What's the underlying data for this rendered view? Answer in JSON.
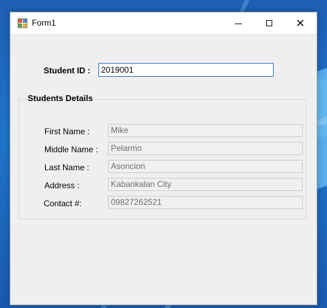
{
  "window": {
    "title": "Form1"
  },
  "student_id": {
    "label": "Student ID :",
    "value": "2019001"
  },
  "student_details": {
    "title": "Students Details",
    "fields": [
      {
        "label": "First Name :",
        "value": "Mike"
      },
      {
        "label": "Middle Name :",
        "value": "Pelarmo"
      },
      {
        "label": "Last Name :",
        "value": "Asoncion"
      },
      {
        "label": "Address :",
        "value": "Kabankalan City"
      },
      {
        "label": "Contact #:",
        "value": "09827262521"
      }
    ]
  },
  "icons": {
    "app": "form-icon",
    "minimize": "minimize-icon",
    "maximize": "maximize-icon",
    "close": "close-icon"
  },
  "colors": {
    "desktop": "#1a63b8",
    "window_background": "#efefef",
    "active_input_border": "#2f78c4",
    "disabled_input_text": "#6d6d6d"
  }
}
